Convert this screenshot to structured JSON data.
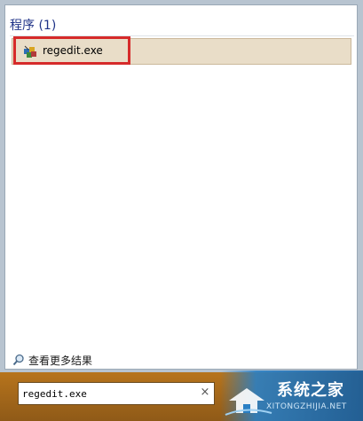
{
  "results": {
    "section_header": "程序 (1)",
    "items": [
      {
        "label": "regedit.exe",
        "icon": "regedit-icon"
      }
    ]
  },
  "more_results": {
    "label": "查看更多结果",
    "icon": "search-icon"
  },
  "search": {
    "value": "regedit.exe",
    "clear_glyph": "×"
  },
  "watermark": {
    "title": "系统之家",
    "subtitle": "XITONGZHIJIA.NET"
  },
  "colors": {
    "section_header": "#1e3287",
    "selected_row": "#e9ddc8",
    "highlight": "#d62a2a",
    "search_strip": "#a8681c"
  }
}
